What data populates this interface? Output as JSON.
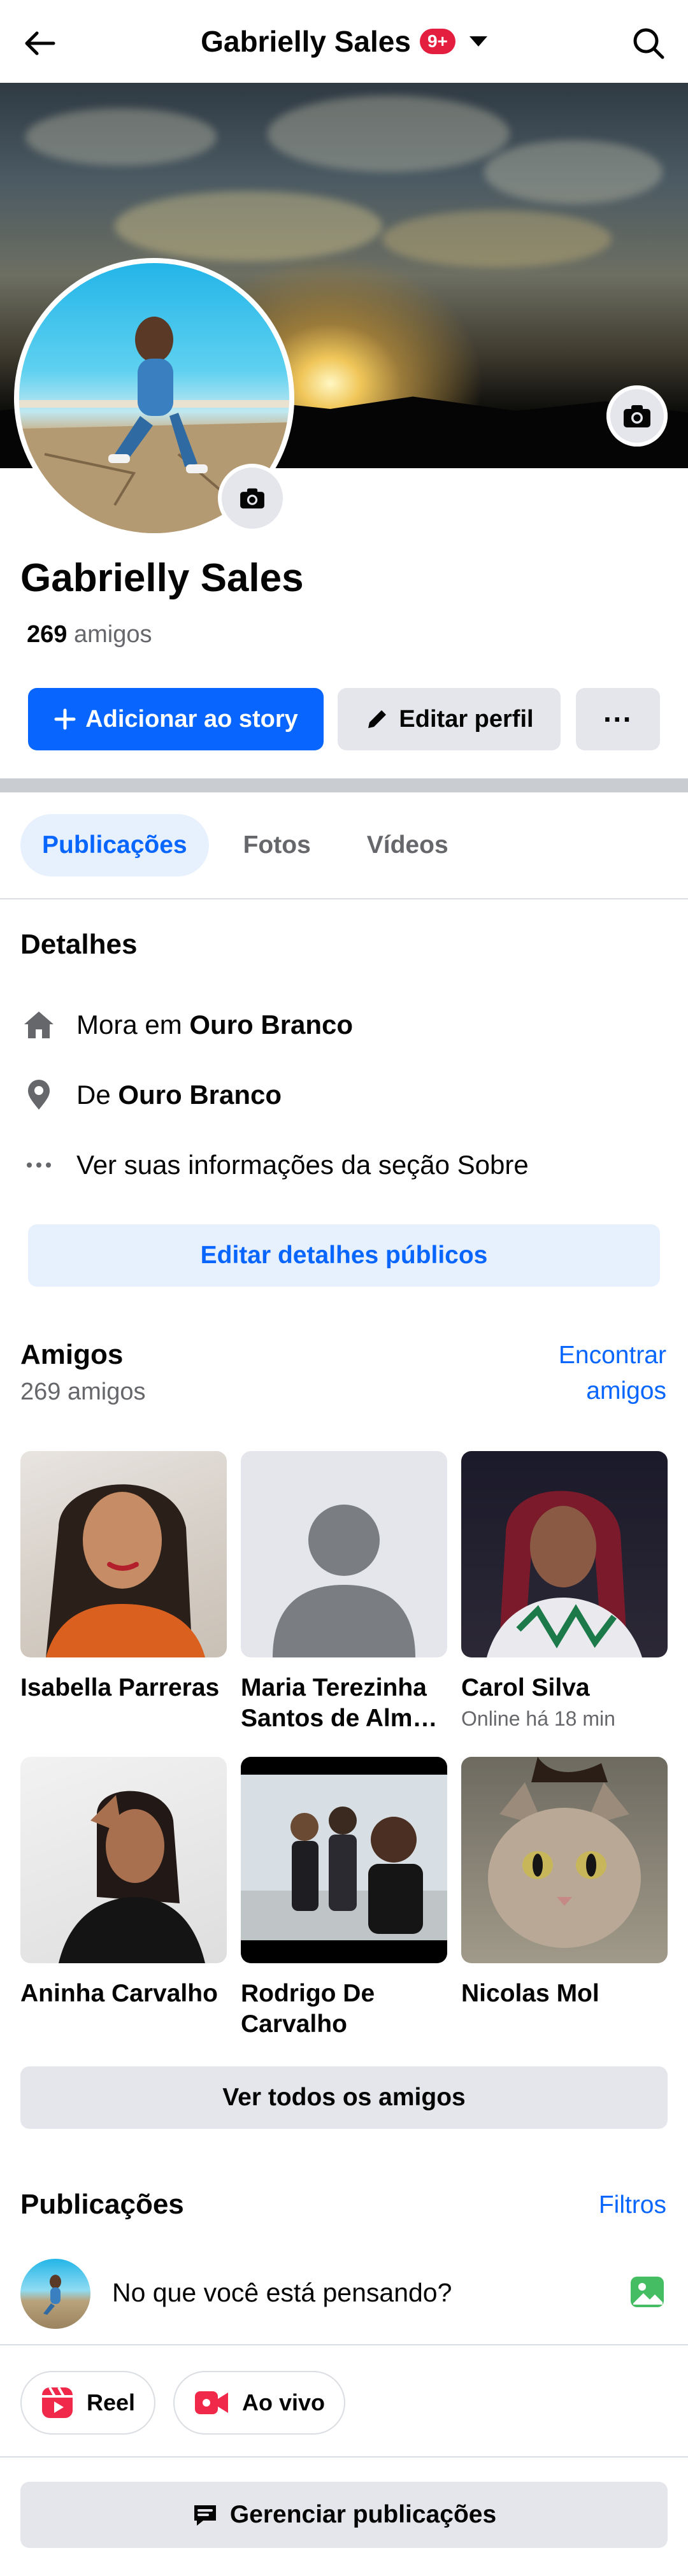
{
  "header": {
    "title": "Gabrielly Sales",
    "notification_badge": "9+"
  },
  "profile": {
    "name": "Gabrielly Sales",
    "friends_number": "269",
    "friends_word": "amigos"
  },
  "actions": {
    "add_story": "Adicionar ao story",
    "edit_profile": "Editar perfil",
    "more": "···"
  },
  "tabs": [
    {
      "label": "Publicações",
      "active": true
    },
    {
      "label": "Fotos",
      "active": false
    },
    {
      "label": "Vídeos",
      "active": false
    }
  ],
  "details": {
    "title": "Detalhes",
    "lives_prefix": "Mora em ",
    "lives_place": "Ouro Branco",
    "from_prefix": "De ",
    "from_place": "Ouro Branco",
    "about": "Ver suas informações da seção Sobre",
    "edit_public": "Editar detalhes públicos"
  },
  "friends": {
    "title": "Amigos",
    "count": "269 amigos",
    "find_line1": "Encontrar",
    "find_line2": "amigos",
    "items": [
      {
        "name": "Isabella Parreras",
        "status": ""
      },
      {
        "name": "Maria Terezinha Santos de Alm…",
        "status": ""
      },
      {
        "name": "Carol Silva",
        "status": "Online há 18 min"
      },
      {
        "name": "Aninha Carvalho",
        "status": ""
      },
      {
        "name": "Rodrigo De Carvalho",
        "status": ""
      },
      {
        "name": "Nicolas Mol",
        "status": ""
      }
    ],
    "see_all": "Ver todos os amigos"
  },
  "posts": {
    "title": "Publicações",
    "filters": "Filtros",
    "composer_prompt": "No que você está pensando?",
    "reel": "Reel",
    "live": "Ao vivo",
    "manage": "Gerenciar publicações"
  },
  "colors": {
    "accent": "#0866ff",
    "badge": "#e41e3f",
    "button_gray": "#e4e6eb"
  },
  "icons": [
    "back-arrow-icon",
    "search-icon",
    "camera-icon",
    "plus-icon",
    "pencil-icon",
    "home-icon",
    "location-pin-icon",
    "ellipsis-icon",
    "photo-icon",
    "reel-icon",
    "live-video-icon",
    "manage-posts-icon"
  ]
}
